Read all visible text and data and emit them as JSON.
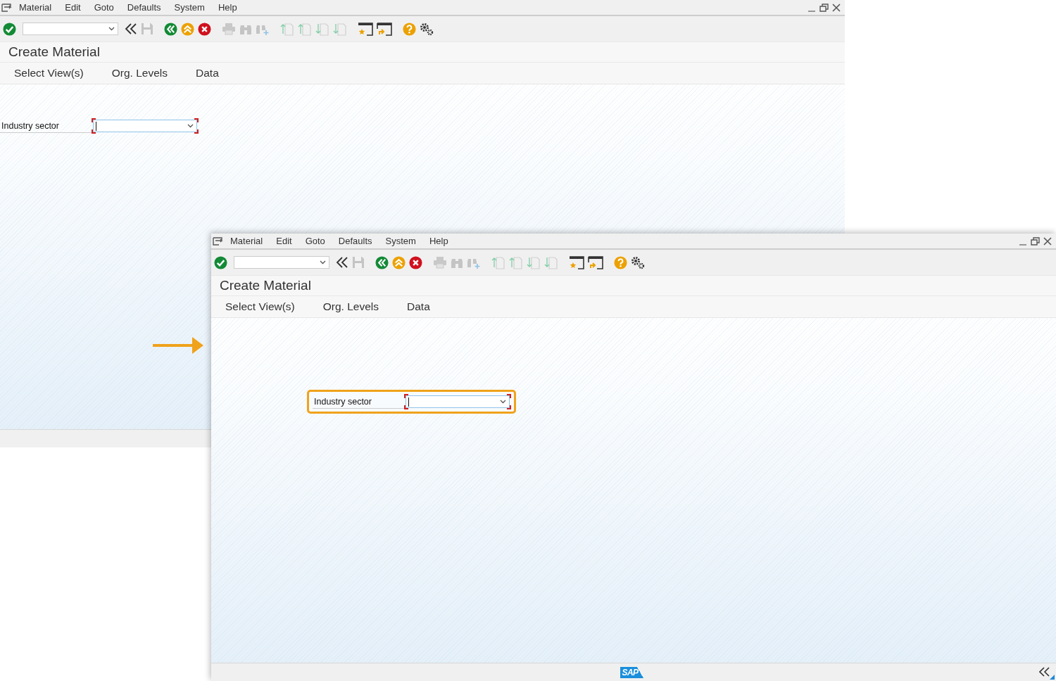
{
  "windows": [
    {
      "menu": [
        "Material",
        "Edit",
        "Goto",
        "Defaults",
        "System",
        "Help"
      ],
      "title": "Create Material",
      "app_toolbar": [
        "Select View(s)",
        "Org. Levels",
        "Data"
      ],
      "field": {
        "label": "Industry sector"
      },
      "highlighted": false,
      "status_bar": {
        "collapse_button": false
      }
    },
    {
      "menu": [
        "Material",
        "Edit",
        "Goto",
        "Defaults",
        "System",
        "Help"
      ],
      "title": "Create Material",
      "app_toolbar": [
        "Select View(s)",
        "Org. Levels",
        "Data"
      ],
      "field": {
        "label": "Industry sector"
      },
      "highlighted": true,
      "status_bar": {
        "logo": "SAP",
        "collapse_button": true
      }
    }
  ]
}
